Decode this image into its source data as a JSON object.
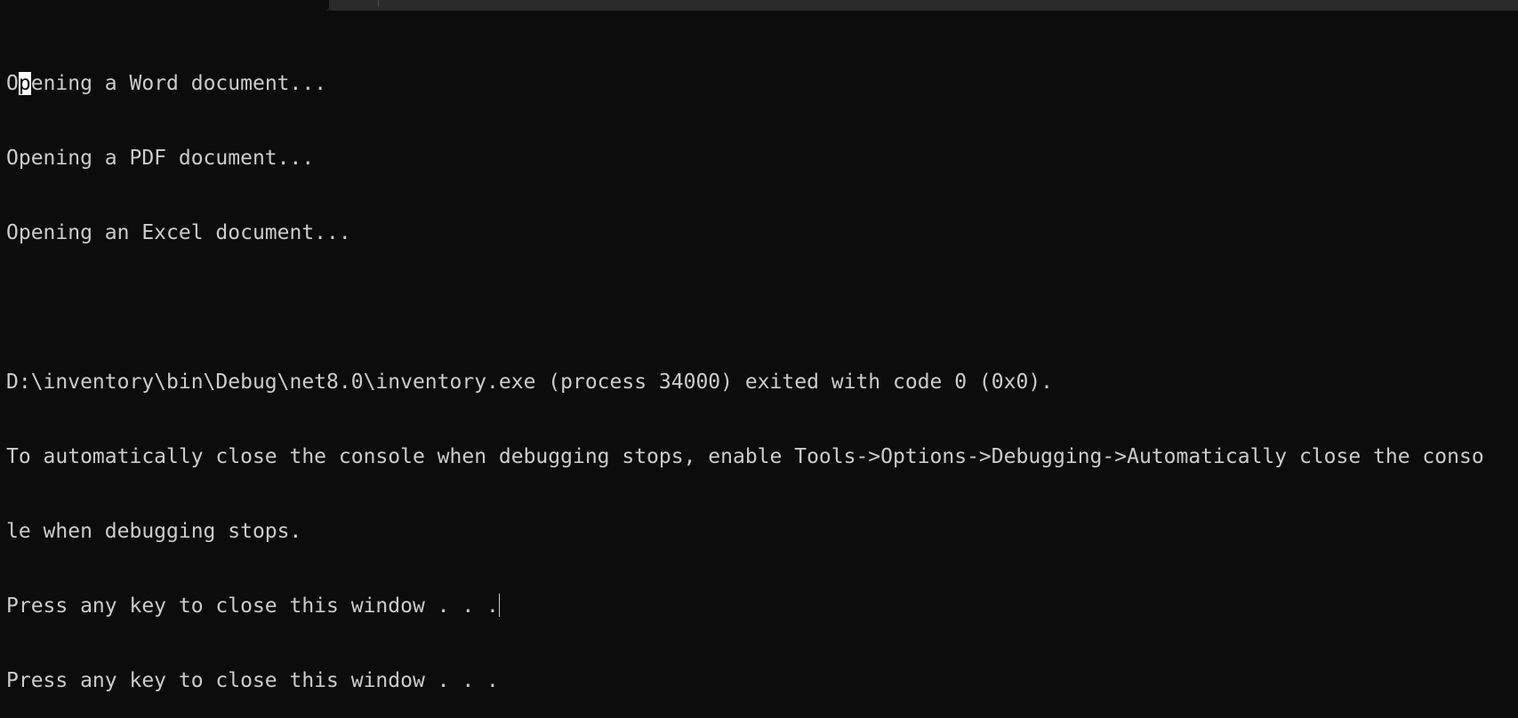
{
  "colors": {
    "background": "#0c0c0c",
    "text": "#cccccc",
    "cursor": "#ffffff",
    "tab_strip": "#2b2b2b"
  },
  "console": {
    "line1_prefix": "O",
    "line1_cursor_char": "p",
    "line1_rest": "ening a Word document...",
    "line2": "Opening a PDF document...",
    "line3": "Opening an Excel document...",
    "line4": "",
    "line5": "D:\\inventory\\bin\\Debug\\net8.0\\inventory.exe (process 34000) exited with code 0 (0x0).",
    "line6": "To automatically close the console when debugging stops, enable Tools->Options->Debugging->Automatically close the conso",
    "line7": "le when debugging stops.",
    "line8": "Press any key to close this window . . .",
    "line9": "Press any key to close this window . . ."
  }
}
